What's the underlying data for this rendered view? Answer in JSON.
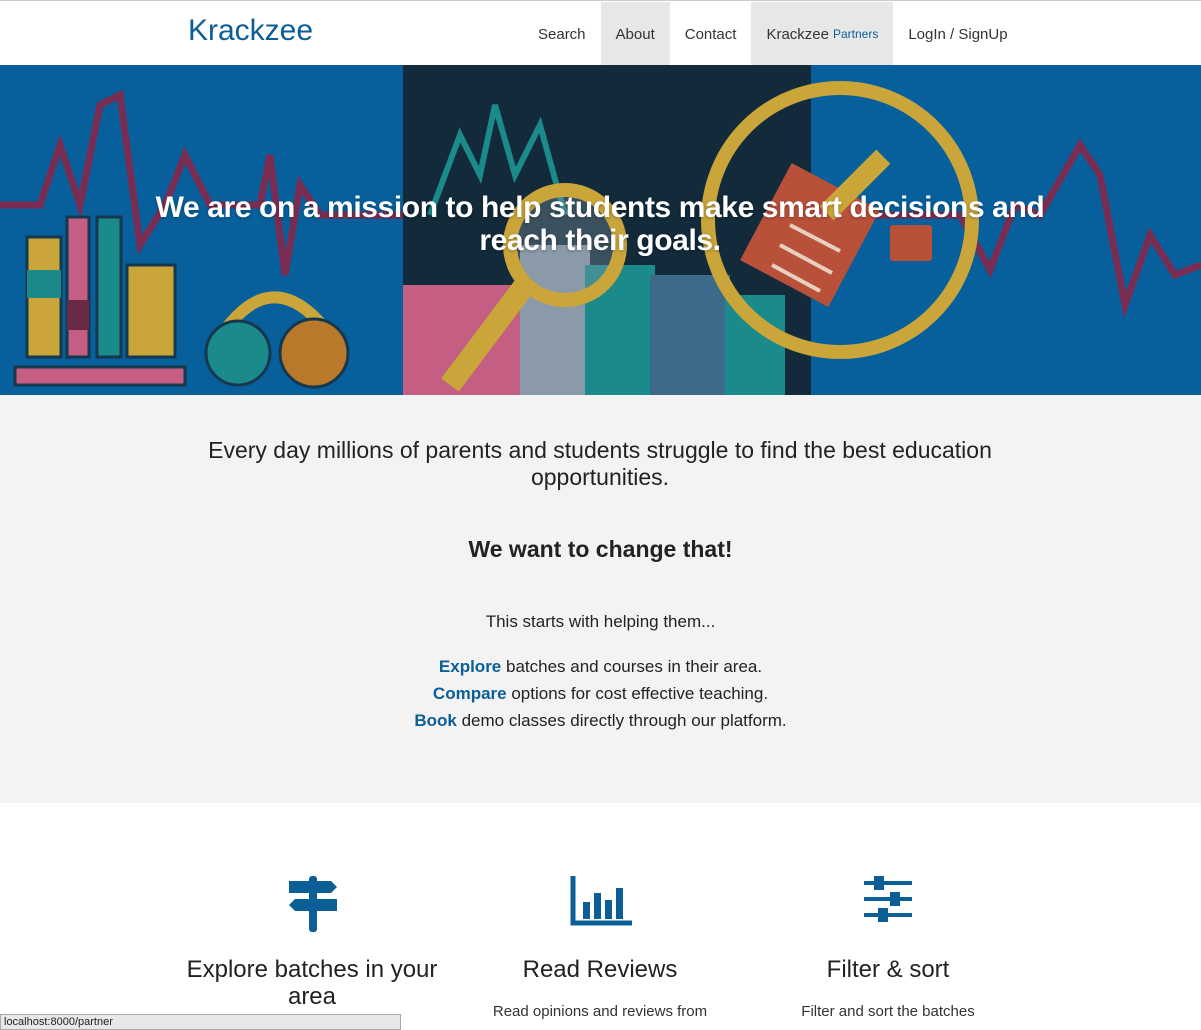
{
  "brand": "Krackzee",
  "nav": {
    "items": [
      {
        "label": "Search"
      },
      {
        "label": "About"
      },
      {
        "label": "Contact"
      },
      {
        "label": "Krackzee",
        "sub": "Partners"
      },
      {
        "label": "LogIn / SignUp"
      }
    ]
  },
  "hero": {
    "headline": "We are on a mission to help students make smart decisions and reach their goals."
  },
  "mission": {
    "lead": "Every day millions of parents and students struggle to find the best education opportunities.",
    "change": "We want to change that!",
    "starts": "This starts with helping them...",
    "lines": [
      {
        "keyword": "Explore",
        "rest": " batches and courses in their area."
      },
      {
        "keyword": "Compare",
        "rest": " options for cost effective teaching."
      },
      {
        "keyword": "Book",
        "rest": " demo classes directly through our platform."
      }
    ]
  },
  "features": [
    {
      "icon": "signpost-icon",
      "title": "Explore batches in your area",
      "text": ""
    },
    {
      "icon": "bar-chart-icon",
      "title": "Read Reviews",
      "text": "Read opinions and reviews from"
    },
    {
      "icon": "sliders-icon",
      "title": "Filter & sort",
      "text": "Filter and sort the batches"
    }
  ],
  "status_url": "localhost:8000/partner",
  "colors": {
    "brand": "#0b5e96",
    "hero_bg": "#07609c",
    "mission_bg": "#f3f3f3"
  }
}
